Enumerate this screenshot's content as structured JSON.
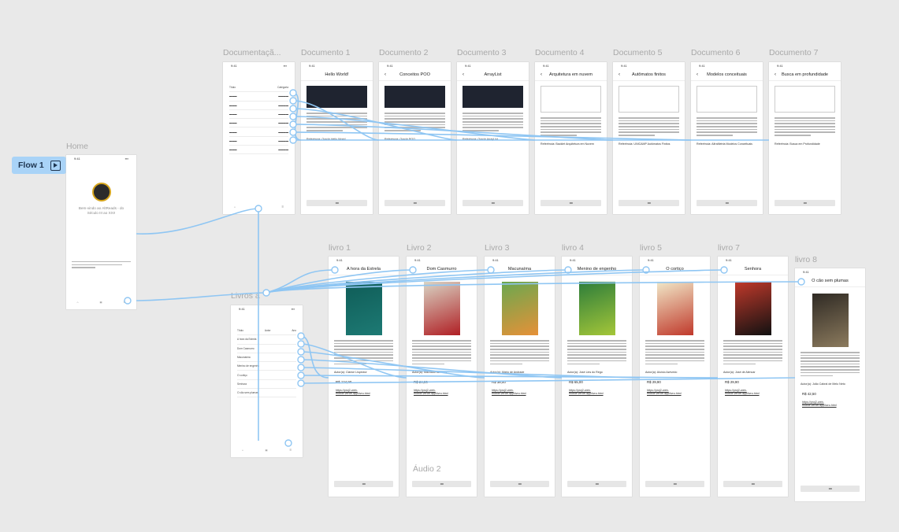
{
  "flow": {
    "label": "Flow 1",
    "icon": "play-icon"
  },
  "frames": {
    "home": {
      "label": "Home",
      "subtitle": "Bem-vindo ao AltReads - do Século III ao XXI!",
      "status_time": "9:41"
    },
    "docs_list": {
      "label": "Documentaçã...",
      "status_time": "9:41",
      "col_a": "Título",
      "col_b": "Categoria"
    },
    "livros_list": {
      "label": "Livros a",
      "status_time": "9:41",
      "col_a": "Título",
      "col_b": "Autor",
      "col_c": "Ano"
    },
    "audio": {
      "label": "Áudio 2"
    }
  },
  "documents": [
    {
      "label": "Documento 1",
      "title": "Hello World!",
      "ref": "Referência: Oracle Hello World"
    },
    {
      "label": "Documento 2",
      "title": "Conceitos POO",
      "ref": "Referência: Oracle POO"
    },
    {
      "label": "Documento 3",
      "title": "ArrayList",
      "ref": "Referência: Oracle ArrayList"
    },
    {
      "label": "Documento 4",
      "title": "Arquitetura em nuvem",
      "ref": "Referência: Backlet Arquitetura em Nuvem"
    },
    {
      "label": "Documento 5",
      "title": "Autômatos finitos",
      "ref": "Referência: UNICAMP Autômatos Finitos"
    },
    {
      "label": "Documento 6",
      "title": "Modelos conceituais",
      "ref": "Referência: AlfraMetria Modelos Conceituais"
    },
    {
      "label": "Documento 7",
      "title": "Busca em profundidade",
      "ref": "Referência: Busca em Profundidade"
    }
  ],
  "books": [
    {
      "label": "livro 1",
      "title": "A hora da Estrela",
      "author": "Autor(a): Clarice Lispector",
      "price": "R$ 124,90",
      "link": "https://proj2-web-mobile.vercel.app/livro.html"
    },
    {
      "label": "Livro 2",
      "title": "Dom Casmurro",
      "author": "Autor(a): Machado de Assis",
      "price": "R$ 24,90",
      "link": "https://proj2-web-mobile.vercel.app/livro.html"
    },
    {
      "label": "Livro 3",
      "title": "Macunaíma",
      "author": "Autor(a): Mário de Andrade",
      "price": "R$ 38,00",
      "link": "https://proj2-web-mobile.vercel.app/livro.html"
    },
    {
      "label": "livro 4",
      "title": "Menino de engenho",
      "author": "Autor(a): José Lins do Rego",
      "price": "R$ 65,00",
      "link": "https://proj2-web-mobile.vercel.app/livro.html"
    },
    {
      "label": "livro 5",
      "title": "O cortiço",
      "author": "Autor(a): Aluísio Azevedo",
      "price": "R$ 29,90",
      "link": "https://proj2-web-mobile.vercel.app/livro.html"
    },
    {
      "label": "livro 7",
      "title": "Senhora",
      "author": "Autor(a): José de Alencar",
      "price": "R$ 29,90",
      "link": "https://proj2-web-mobile.vercel.app/livro.html"
    },
    {
      "label": "livro 8",
      "title": "O cão sem plumas",
      "author": "Autor(a): João Cabral de Melo Neto",
      "price": "R$ 42,50",
      "link": "https://proj2-web-mobile.vercel.app/livro.html"
    }
  ],
  "colors": {
    "canvas": "#e9e9e9",
    "wire": "#8fc6f3",
    "badge": "#a9d3f7"
  }
}
